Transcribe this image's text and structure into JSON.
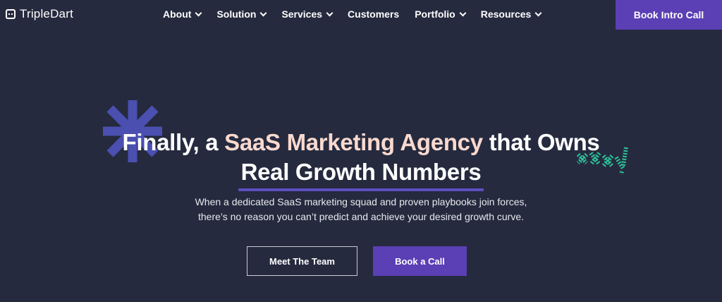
{
  "brand": {
    "name": "TripleDart",
    "icon": "terminal-dots-icon"
  },
  "nav": {
    "items": [
      {
        "label": "About",
        "has_dropdown": true
      },
      {
        "label": "Solution",
        "has_dropdown": true
      },
      {
        "label": "Services",
        "has_dropdown": true
      },
      {
        "label": "Customers",
        "has_dropdown": false
      },
      {
        "label": "Portfolio",
        "has_dropdown": true
      },
      {
        "label": "Resources",
        "has_dropdown": true
      }
    ],
    "cta_label": "Book Intro Call"
  },
  "hero": {
    "headline_prefix": "Finally, a",
    "headline_accent": "SaaS Marketing Agency",
    "headline_suffix": "that Owns",
    "headline_line2": "Real Growth Numbers",
    "subtitle_line1": "When a dedicated SaaS marketing squad and proven playbooks join forces,",
    "subtitle_line2": "there’s no reason you can’t predict and achieve your desired growth curve.",
    "secondary_button": "Meet The Team",
    "primary_button": "Book a Call",
    "decor_left": "asterisk-icon",
    "decor_right": "squiggle-icon"
  },
  "colors": {
    "background": "#252a3e",
    "brand_purple": "#5b3fb5",
    "accent_text": "#f9d9cf",
    "asterisk": "#4a4fb0",
    "squiggle": "#2ec49a",
    "underline": "#5b4ec0"
  }
}
